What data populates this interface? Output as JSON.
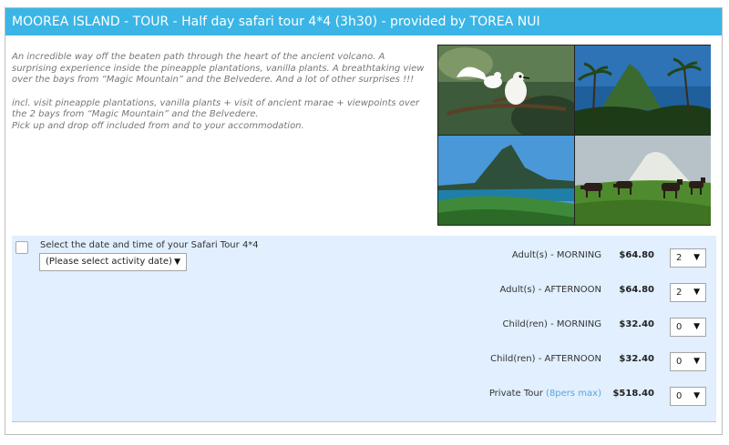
{
  "tour": {
    "title": "MOOREA ISLAND - TOUR - Half day safari tour 4*4 (3h30) - provided by TOREA NUI",
    "description_1": "An incredible way off the beaten path through the heart of the ancient volcano. A surprising experience inside the pineapple plantations, vanilla plants. A breathtaking view over the bays from “Magic Mountain” and the Belvedere. And a lot of other surprises !!!",
    "description_2": "incl. visit pineapple plantations, vanilla plants + visit of ancient marae + viewpoints over the 2 bays from “Magic Mountain” and the Belvedere.",
    "description_3": "Pick up and drop off included from and to your accommodation.",
    "photos": [
      "white-terns-photo",
      "palm-peak-photo",
      "lagoon-mountain-photo",
      "horses-photo"
    ]
  },
  "booking": {
    "select_label": "Select the date and time of your Safari Tour 4*4",
    "date_select": "(Please select activity date)",
    "rows": [
      {
        "label": "Adult(s) - MORNING",
        "note": "",
        "price": "$64.80",
        "qty": "2"
      },
      {
        "label": "Adult(s) - AFTERNOON",
        "note": "",
        "price": "$64.80",
        "qty": "2"
      },
      {
        "label": "Child(ren) - MORNING",
        "note": "",
        "price": "$32.40",
        "qty": "0"
      },
      {
        "label": "Child(ren) - AFTERNOON",
        "note": "",
        "price": "$32.40",
        "qty": "0"
      },
      {
        "label": "Private Tour",
        "note": "(8pers max)",
        "price": "$518.40",
        "qty": "0"
      }
    ]
  },
  "colors": {
    "title_bar": "#3ab5e6",
    "booking_bg": "#e1efff",
    "note_text": "#58a6d8"
  }
}
